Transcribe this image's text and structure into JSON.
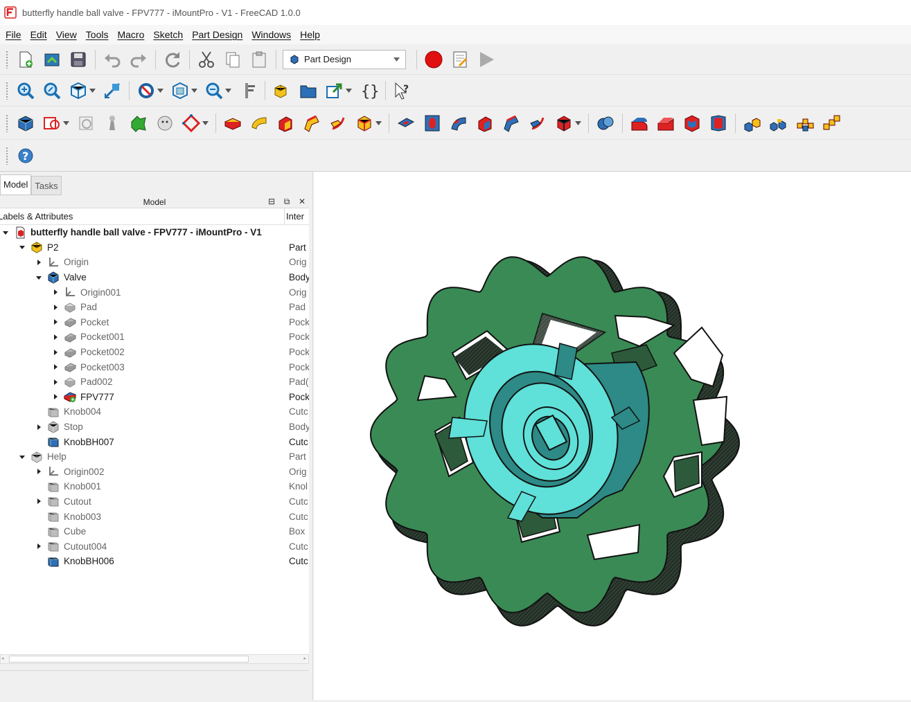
{
  "window": {
    "title": "butterfly handle ball valve - FPV777 - iMountPro - V1 - FreeCAD 1.0.0",
    "app_icon": "freecad-icon"
  },
  "menu": [
    "File",
    "Edit",
    "View",
    "Tools",
    "Macro",
    "Sketch",
    "Part Design",
    "Windows",
    "Help"
  ],
  "workbench": {
    "selected": "Part Design"
  },
  "panel": {
    "tabs": [
      "Model",
      "Tasks"
    ],
    "dock_title": "Model",
    "columns": [
      "Labels & Attributes",
      "Inter"
    ]
  },
  "tree": [
    {
      "label": "butterfly handle ball valve - FPV777 - iMountPro - V1",
      "value": "",
      "depth": 0,
      "expander": "open",
      "icon": "document-icon",
      "bold": true,
      "dim": false
    },
    {
      "label": "P2",
      "value": "Part",
      "depth": 1,
      "expander": "open",
      "icon": "part-icon",
      "bold": false,
      "dim": false
    },
    {
      "label": "Origin",
      "value": "Orig",
      "depth": 2,
      "expander": "closed",
      "icon": "origin-icon",
      "bold": false,
      "dim": true
    },
    {
      "label": "Valve",
      "value": "Body",
      "depth": 2,
      "expander": "open",
      "icon": "body-icon",
      "bold": false,
      "dim": false
    },
    {
      "label": "Origin001",
      "value": "Orig",
      "depth": 3,
      "expander": "closed",
      "icon": "origin-icon",
      "bold": false,
      "dim": true
    },
    {
      "label": "Pad",
      "value": "Pad",
      "depth": 3,
      "expander": "closed",
      "icon": "pad-icon",
      "bold": false,
      "dim": true
    },
    {
      "label": "Pocket",
      "value": "Pock",
      "depth": 3,
      "expander": "closed",
      "icon": "pocket-icon",
      "bold": false,
      "dim": true
    },
    {
      "label": "Pocket001",
      "value": "Pock",
      "depth": 3,
      "expander": "closed",
      "icon": "pocket-icon",
      "bold": false,
      "dim": true
    },
    {
      "label": "Pocket002",
      "value": "Pock",
      "depth": 3,
      "expander": "closed",
      "icon": "pocket-icon",
      "bold": false,
      "dim": true
    },
    {
      "label": "Pocket003",
      "value": "Pock",
      "depth": 3,
      "expander": "closed",
      "icon": "pocket-icon",
      "bold": false,
      "dim": true
    },
    {
      "label": "Pad002",
      "value": "Pad(",
      "depth": 3,
      "expander": "closed",
      "icon": "pad-icon",
      "bold": false,
      "dim": true
    },
    {
      "label": "FPV777",
      "value": "Pock",
      "depth": 3,
      "expander": "closed",
      "icon": "pocket-tip-icon",
      "bold": false,
      "dim": false
    },
    {
      "label": "Knob004",
      "value": "Cutc",
      "depth": 2,
      "expander": "none",
      "icon": "cube-gray-icon",
      "bold": false,
      "dim": true
    },
    {
      "label": "Stop",
      "value": "Body",
      "depth": 2,
      "expander": "closed",
      "icon": "body-gray-icon",
      "bold": false,
      "dim": true
    },
    {
      "label": "KnobBH007",
      "value": "Cutc",
      "depth": 2,
      "expander": "none",
      "icon": "cube-blue-icon",
      "bold": false,
      "dim": false
    },
    {
      "label": "Help",
      "value": "Part",
      "depth": 1,
      "expander": "open",
      "icon": "part-gray-icon",
      "bold": false,
      "dim": true
    },
    {
      "label": "Origin002",
      "value": "Orig",
      "depth": 2,
      "expander": "closed",
      "icon": "origin-icon",
      "bold": false,
      "dim": true
    },
    {
      "label": "Knob001",
      "value": "Knol",
      "depth": 2,
      "expander": "none",
      "icon": "cube-gray-icon",
      "bold": false,
      "dim": true
    },
    {
      "label": "Cutout",
      "value": "Cutc",
      "depth": 2,
      "expander": "closed",
      "icon": "cube-gray-icon",
      "bold": false,
      "dim": true
    },
    {
      "label": "Knob003",
      "value": "Cutc",
      "depth": 2,
      "expander": "none",
      "icon": "cube-gray-icon",
      "bold": false,
      "dim": true
    },
    {
      "label": "Cube",
      "value": "Box",
      "depth": 2,
      "expander": "none",
      "icon": "cube-gray-icon",
      "bold": false,
      "dim": true
    },
    {
      "label": "Cutout004",
      "value": "Cutc",
      "depth": 2,
      "expander": "closed",
      "icon": "cube-gray-icon",
      "bold": false,
      "dim": true
    },
    {
      "label": "KnobBH006",
      "value": "Cutc",
      "depth": 2,
      "expander": "none",
      "icon": "cube-blue-icon",
      "bold": false,
      "dim": false
    }
  ],
  "colors": {
    "gear_green": "#3a8a55",
    "hub_cyan": "#5fe0d8",
    "hub_dark": "#2d8a86",
    "accent_red": "#e01010"
  }
}
